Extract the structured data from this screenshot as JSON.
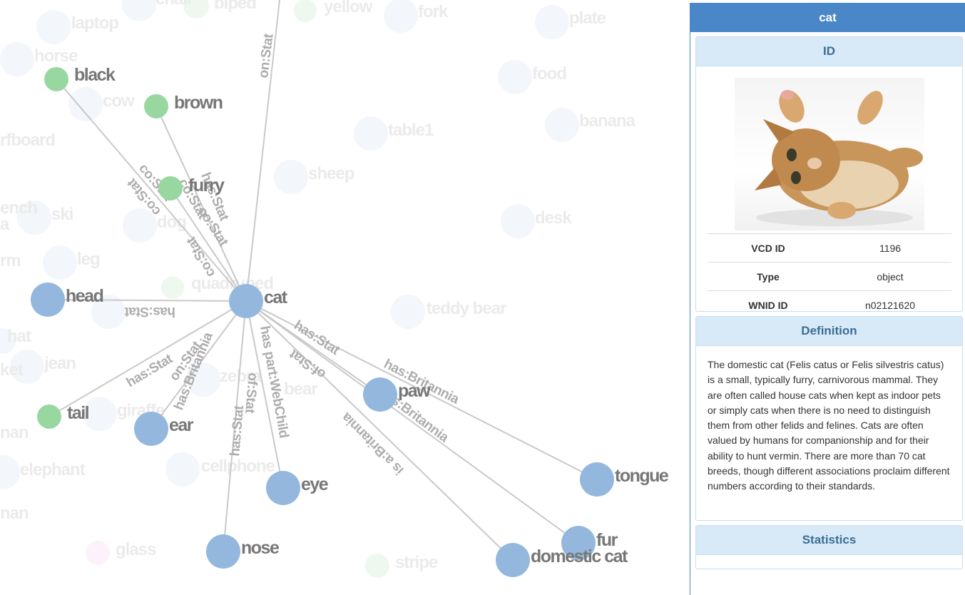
{
  "graph": {
    "faded_nodes": [
      "laptop",
      "chair",
      "biped",
      "yellow",
      "fork",
      "plate",
      "horse",
      "food",
      "cow",
      "banana",
      "table1",
      "surfboard",
      "sheep",
      "bench",
      "ski",
      "desk",
      "dog",
      "leg",
      "quadruped",
      "teddy bear",
      "hat",
      "jean",
      "zebra",
      "bear",
      "giraffe",
      "elephant",
      "cellphone",
      "glass",
      "stripe",
      "man",
      "ket",
      "rm",
      "a",
      "nan"
    ],
    "nodes": {
      "cat": "cat",
      "black": "black",
      "brown": "brown",
      "furry": "furry",
      "head": "head",
      "tail": "tail",
      "ear": "ear",
      "paw": "paw",
      "eye": "eye",
      "nose": "nose",
      "tongue": "tongue",
      "fur": "fur",
      "domestic_cat": "domestic cat"
    },
    "edge_labels": {
      "on_stat_top": "on:Stat",
      "co_stat_1": "co:Stat",
      "co_stat_2": "co:Stat",
      "has_stat_1": "has:Stat",
      "co_stat_3": "co:Stat",
      "co_stat_4": "co:Stat",
      "co_stat_5": "co:Stat",
      "has_stat_head": "has:Stat",
      "has_stat_tail": "has:Stat",
      "on_stat_ear": "on:Stat",
      "has_britannia_ear": "has:Britannia",
      "of_stat_nose": "of:Stat",
      "has_stat_nose": "has:Stat",
      "has_part_webchild": "has part:WebChild",
      "has_stat_paw": "has:Stat",
      "of_stat_paw": "of:Stat",
      "has_britannia_tongue": "has:Britannia",
      "has_britannia_fur": "has:Britannia",
      "is_a_britannia": "is a:Britannia"
    },
    "colors": {
      "object": "#94b8dd",
      "attribute": "#98d7a0",
      "faded": "#f3f6fa"
    }
  },
  "panel": {
    "title": "cat",
    "id_section": {
      "header": "ID",
      "rows": [
        {
          "key": "VCD ID",
          "value": "1196"
        },
        {
          "key": "Type",
          "value": "object"
        },
        {
          "key": "WNID ID",
          "value": "n02121620"
        }
      ]
    },
    "definition_section": {
      "header": "Definition",
      "text": "The domestic cat (Felis catus or Felis silvestris catus) is a small, typically furry, carnivorous mammal. They are often called house cats when kept as indoor pets or simply cats when there is no need to distinguish them from other felids and felines. Cats are often valued by humans for companionship and for their ability to hunt vermin. There are more than 70 cat breeds, though different associations proclaim different numbers according to their standards."
    },
    "statistics_section": {
      "header": "Statistics"
    }
  }
}
